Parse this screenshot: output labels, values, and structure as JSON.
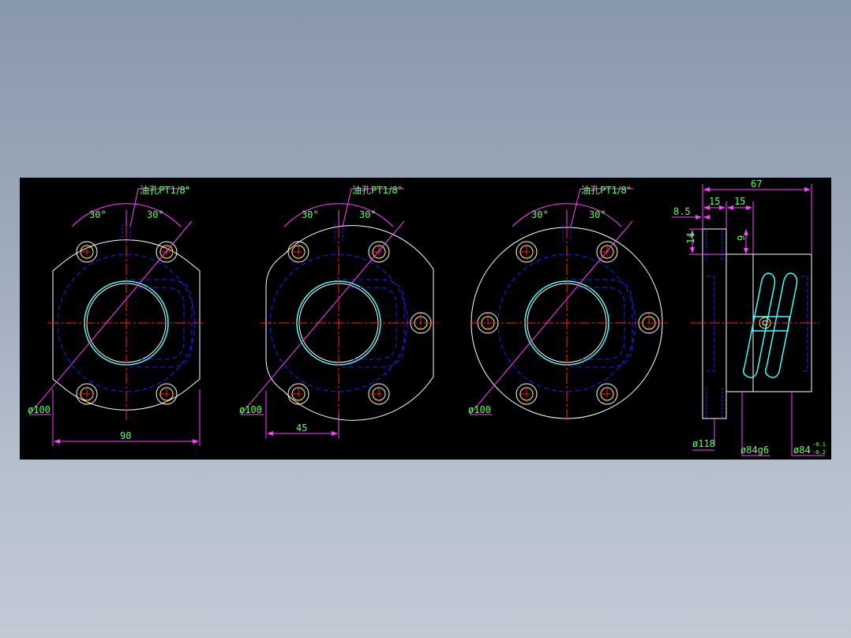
{
  "views": [
    {
      "oil_hole_label": "油孔PT1/8\"",
      "angle_left": "30°",
      "angle_right": "30°",
      "pcd_label": "ø100",
      "width_dim": "90"
    },
    {
      "oil_hole_label": "油孔PT1/8\"",
      "angle_left": "30°",
      "angle_right": "30°",
      "pcd_label": "ø100",
      "offset_dim": "45"
    },
    {
      "oil_hole_label": "油孔PT1/8\"",
      "angle_left": "30°",
      "angle_right": "30°",
      "pcd_label": "ø100"
    }
  ],
  "side_view": {
    "length_dim": "67",
    "flange_dim": "15",
    "step_dim": "15",
    "offset_dim": "8.5",
    "height_dim": "14",
    "hole_dim": "9",
    "flange_dia": "ø118",
    "pilot_dia": "ø84g6",
    "body_dia": "ø84",
    "tol_upper": "-0.1",
    "tol_lower": "-0.2"
  },
  "colors": {
    "background": "#000000",
    "outline": "#ffffff",
    "hidden": "#2020ff",
    "center": "#ff2020",
    "dimension": "#ff40ff",
    "text": "#5fff5f",
    "bore": "#40ffff"
  }
}
